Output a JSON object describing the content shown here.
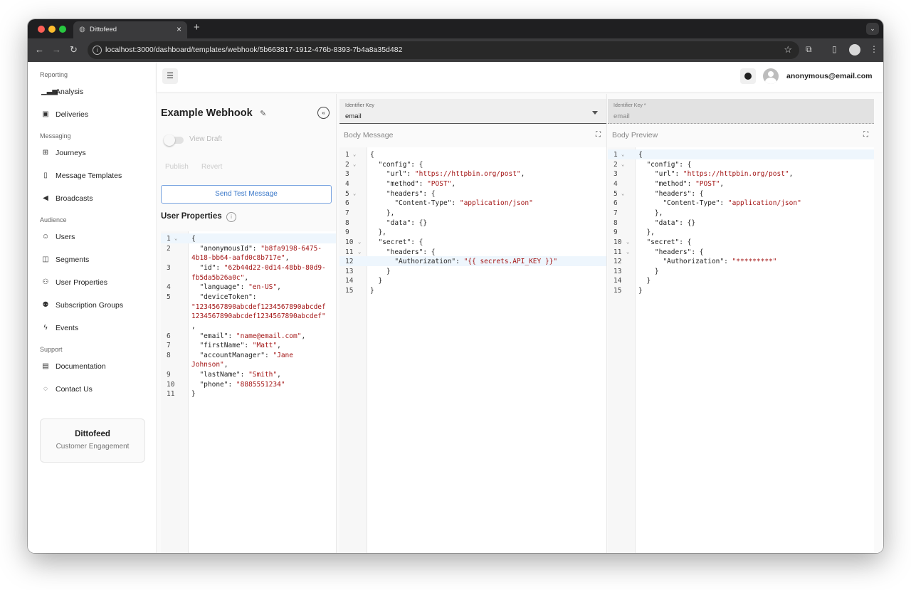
{
  "browser": {
    "tab_title": "Dittofeed",
    "url": "localhost:3000/dashboard/templates/webhook/5b663817-1912-476b-8393-7b4a8a35d482"
  },
  "sidebar": {
    "sections": [
      {
        "title": "Reporting",
        "items": [
          {
            "label": "Analysis",
            "icon": "bar-chart-icon"
          },
          {
            "label": "Deliveries",
            "icon": "inbox-icon"
          }
        ]
      },
      {
        "title": "Messaging",
        "items": [
          {
            "label": "Journeys",
            "icon": "journeys-icon"
          },
          {
            "label": "Message Templates",
            "icon": "file-icon"
          },
          {
            "label": "Broadcasts",
            "icon": "megaphone-icon"
          }
        ]
      },
      {
        "title": "Audience",
        "items": [
          {
            "label": "Users",
            "icon": "user-icon"
          },
          {
            "label": "Segments",
            "icon": "segments-icon"
          },
          {
            "label": "User Properties",
            "icon": "user-properties-icon"
          },
          {
            "label": "Subscription Groups",
            "icon": "group-icon"
          },
          {
            "label": "Events",
            "icon": "bolt-icon"
          }
        ]
      },
      {
        "title": "Support",
        "items": [
          {
            "label": "Documentation",
            "icon": "book-icon"
          },
          {
            "label": "Contact Us",
            "icon": "chat-icon"
          }
        ]
      }
    ],
    "brand": {
      "name": "Dittofeed",
      "tagline": "Customer Engagement"
    }
  },
  "header": {
    "user_email": "anonymous@email.com"
  },
  "template": {
    "title": "Example Webhook",
    "view_draft_label": "View Draft",
    "publish_label": "Publish",
    "revert_label": "Revert",
    "send_test_label": "Send Test Message",
    "user_properties_label": "User Properties"
  },
  "user_properties_code": [
    {
      "n": "1",
      "fold": true,
      "parts": [
        [
          "p",
          "{"
        ]
      ]
    },
    {
      "n": "2",
      "parts": [
        [
          "p",
          "  \"anonymousId\": "
        ],
        [
          "s",
          "\"b8fa9198-6475-"
        ]
      ]
    },
    {
      "n": "",
      "parts": [
        [
          "s",
          "4b18-bb64-aafd0c8b717e\""
        ],
        [
          "p",
          ","
        ]
      ]
    },
    {
      "n": "3",
      "parts": [
        [
          "p",
          "  \"id\": "
        ],
        [
          "s",
          "\"62b44d22-0d14-48bb-80d9-"
        ]
      ]
    },
    {
      "n": "",
      "parts": [
        [
          "s",
          "fb5da5b26a0c\""
        ],
        [
          "p",
          ","
        ]
      ]
    },
    {
      "n": "4",
      "parts": [
        [
          "p",
          "  \"language\": "
        ],
        [
          "s",
          "\"en-US\""
        ],
        [
          "p",
          ","
        ]
      ]
    },
    {
      "n": "5",
      "parts": [
        [
          "p",
          "  \"deviceToken\":"
        ]
      ]
    },
    {
      "n": "",
      "parts": [
        [
          "s",
          "\"1234567890abcdef1234567890abcdef"
        ]
      ]
    },
    {
      "n": "",
      "parts": [
        [
          "s",
          "1234567890abcdef1234567890abcdef\""
        ]
      ]
    },
    {
      "n": "",
      "parts": [
        [
          "p",
          ","
        ]
      ]
    },
    {
      "n": "6",
      "parts": [
        [
          "p",
          "  \"email\": "
        ],
        [
          "s",
          "\"name@email.com\""
        ],
        [
          "p",
          ","
        ]
      ]
    },
    {
      "n": "7",
      "parts": [
        [
          "p",
          "  \"firstName\": "
        ],
        [
          "s",
          "\"Matt\""
        ],
        [
          "p",
          ","
        ]
      ]
    },
    {
      "n": "8",
      "parts": [
        [
          "p",
          "  \"accountManager\": "
        ],
        [
          "s",
          "\"Jane"
        ]
      ]
    },
    {
      "n": "",
      "parts": [
        [
          "s",
          "Johnson\""
        ],
        [
          "p",
          ","
        ]
      ]
    },
    {
      "n": "9",
      "parts": [
        [
          "p",
          "  \"lastName\": "
        ],
        [
          "s",
          "\"Smith\""
        ],
        [
          "p",
          ","
        ]
      ]
    },
    {
      "n": "10",
      "parts": [
        [
          "p",
          "  \"phone\": "
        ],
        [
          "s",
          "\"8885551234\""
        ]
      ]
    },
    {
      "n": "11",
      "parts": [
        [
          "p",
          "}"
        ]
      ]
    }
  ],
  "body_message": {
    "identifier_label": "Identifier Key",
    "identifier_value": "email",
    "label": "Body Message",
    "code": [
      {
        "n": "1",
        "fold": true,
        "parts": [
          [
            "p",
            "{"
          ]
        ]
      },
      {
        "n": "2",
        "fold": true,
        "parts": [
          [
            "p",
            "  \"config\": {"
          ]
        ]
      },
      {
        "n": "3",
        "parts": [
          [
            "p",
            "    \"url\": "
          ],
          [
            "s",
            "\"https://httpbin.org/post\""
          ],
          [
            "p",
            ","
          ]
        ]
      },
      {
        "n": "4",
        "parts": [
          [
            "p",
            "    \"method\": "
          ],
          [
            "s",
            "\"POST\""
          ],
          [
            "p",
            ","
          ]
        ]
      },
      {
        "n": "5",
        "fold": true,
        "parts": [
          [
            "p",
            "    \"headers\": {"
          ]
        ]
      },
      {
        "n": "6",
        "parts": [
          [
            "p",
            "      \"Content-Type\": "
          ],
          [
            "s",
            "\"application/json\""
          ]
        ]
      },
      {
        "n": "7",
        "parts": [
          [
            "p",
            "    },"
          ]
        ]
      },
      {
        "n": "8",
        "parts": [
          [
            "p",
            "    \"data\": {}"
          ]
        ]
      },
      {
        "n": "9",
        "parts": [
          [
            "p",
            "  },"
          ]
        ]
      },
      {
        "n": "10",
        "fold": true,
        "parts": [
          [
            "p",
            "  \"secret\": {"
          ]
        ]
      },
      {
        "n": "11",
        "fold": true,
        "parts": [
          [
            "p",
            "    \"headers\": {"
          ]
        ]
      },
      {
        "n": "12",
        "parts": [
          [
            "p",
            "      \"Authorization\": "
          ],
          [
            "s",
            "\"{{ secrets.API_KEY }}\""
          ]
        ]
      },
      {
        "n": "13",
        "parts": [
          [
            "p",
            "    }"
          ]
        ]
      },
      {
        "n": "14",
        "parts": [
          [
            "p",
            "  }"
          ]
        ]
      },
      {
        "n": "15",
        "parts": [
          [
            "p",
            "}"
          ]
        ]
      }
    ]
  },
  "body_preview": {
    "identifier_label": "Identifier Key *",
    "identifier_value": "email",
    "label": "Body Preview",
    "code": [
      {
        "n": "1",
        "fold": true,
        "parts": [
          [
            "p",
            "{"
          ]
        ]
      },
      {
        "n": "2",
        "fold": true,
        "parts": [
          [
            "p",
            "  \"config\": {"
          ]
        ]
      },
      {
        "n": "3",
        "parts": [
          [
            "p",
            "    \"url\": "
          ],
          [
            "s",
            "\"https://httpbin.org/post\""
          ],
          [
            "p",
            ","
          ]
        ]
      },
      {
        "n": "4",
        "parts": [
          [
            "p",
            "    \"method\": "
          ],
          [
            "s",
            "\"POST\""
          ],
          [
            "p",
            ","
          ]
        ]
      },
      {
        "n": "5",
        "fold": true,
        "parts": [
          [
            "p",
            "    \"headers\": {"
          ]
        ]
      },
      {
        "n": "6",
        "parts": [
          [
            "p",
            "      \"Content-Type\": "
          ],
          [
            "s",
            "\"application/json\""
          ]
        ]
      },
      {
        "n": "7",
        "parts": [
          [
            "p",
            "    },"
          ]
        ]
      },
      {
        "n": "8",
        "parts": [
          [
            "p",
            "    \"data\": {}"
          ]
        ]
      },
      {
        "n": "9",
        "parts": [
          [
            "p",
            "  },"
          ]
        ]
      },
      {
        "n": "10",
        "fold": true,
        "parts": [
          [
            "p",
            "  \"secret\": {"
          ]
        ]
      },
      {
        "n": "11",
        "fold": true,
        "parts": [
          [
            "p",
            "    \"headers\": {"
          ]
        ]
      },
      {
        "n": "12",
        "parts": [
          [
            "p",
            "      \"Authorization\": "
          ],
          [
            "s",
            "\"*********\""
          ]
        ]
      },
      {
        "n": "13",
        "parts": [
          [
            "p",
            "    }"
          ]
        ]
      },
      {
        "n": "14",
        "parts": [
          [
            "p",
            "  }"
          ]
        ]
      },
      {
        "n": "15",
        "parts": [
          [
            "p",
            "}"
          ]
        ]
      }
    ]
  },
  "colors": {
    "string": "#a31515",
    "accent": "#3a78c9",
    "chrome": "#1f1f21"
  }
}
